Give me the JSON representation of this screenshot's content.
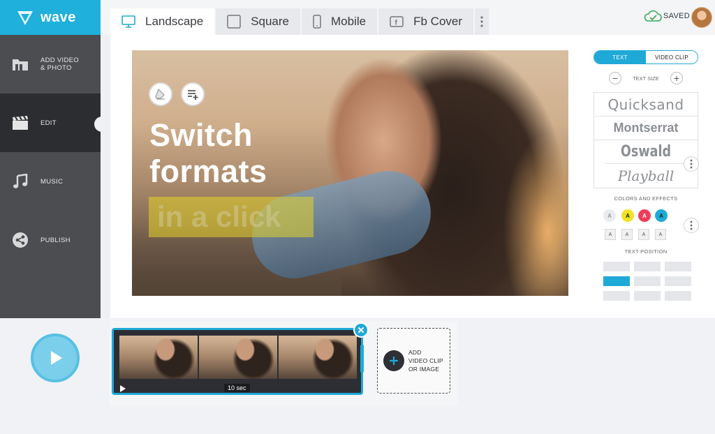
{
  "app": {
    "name": "wave"
  },
  "sidebar": {
    "items": [
      {
        "label": "ADD VIDEO\n& PHOTO",
        "icon": "folder-icon"
      },
      {
        "label": "EDIT",
        "icon": "clapperboard-icon"
      },
      {
        "label": "MUSIC",
        "icon": "music-note-icon"
      },
      {
        "label": "PUBLISH",
        "icon": "share-icon"
      }
    ]
  },
  "tabs": [
    {
      "label": "Landscape",
      "icon": "monitor-icon"
    },
    {
      "label": "Square",
      "icon": "square-icon"
    },
    {
      "label": "Mobile",
      "icon": "phone-icon"
    },
    {
      "label": "Fb Cover",
      "icon": "facebook-icon"
    }
  ],
  "status": {
    "saved_label": "SAVED"
  },
  "preview": {
    "headline_line1": "Switch",
    "headline_line2": "formats",
    "highlight_text": "in a click"
  },
  "panel": {
    "tab_text": "TEXT",
    "tab_video_clip": "VIDEO CLIP",
    "text_size_label": "TEXT SIZE",
    "fonts": [
      "Quicksand",
      "Montserrat",
      "Oswald",
      "Playball"
    ],
    "colors_label": "COLORS AND EFFECTS",
    "swatch_letter": "A",
    "swatch_colors": [
      "#e9ecef",
      "#f2e226",
      "#ec3d5b",
      "#1fa9d7"
    ],
    "text_position_label": "TEXT POSITION",
    "selected_position": "middle-left"
  },
  "timeline": {
    "clip_duration": "10 sec",
    "add_label": "ADD\nVIDEO CLIP\nOR IMAGE"
  },
  "colors": {
    "accent": "#1fa9d7",
    "sidebar": "#4b4d51",
    "sidebar_active": "#2c2d30",
    "saved_green": "#3aa95a"
  }
}
